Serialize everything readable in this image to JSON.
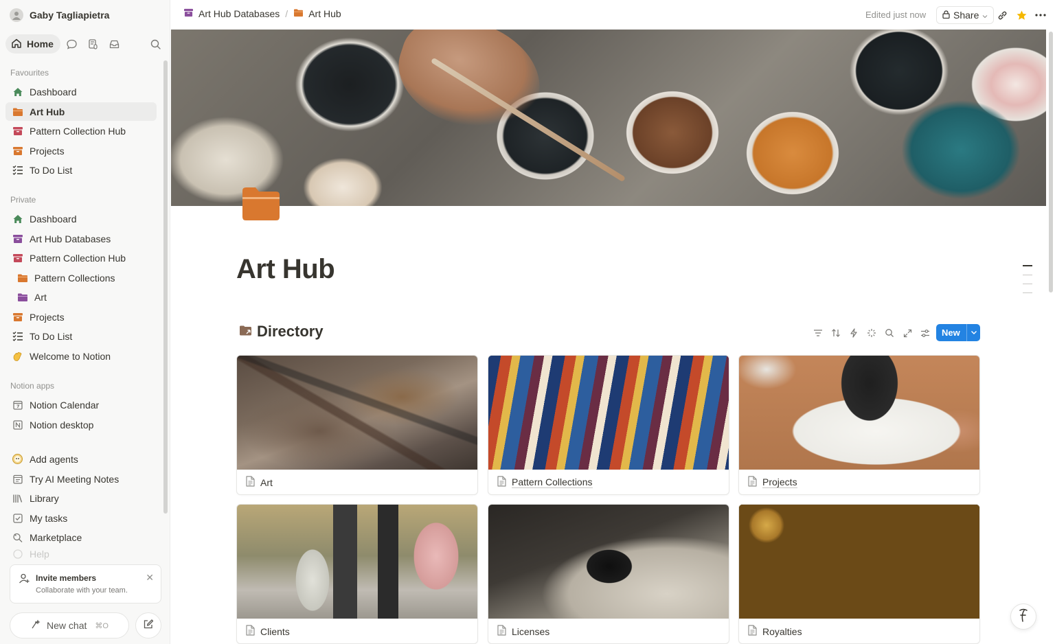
{
  "workspace": {
    "name": "Gaby Tagliapietra"
  },
  "sidebar": {
    "home_label": "Home",
    "favourites_label": "Favourites",
    "favourites": [
      {
        "label": "Dashboard",
        "icon": "house-icon"
      },
      {
        "label": "Art Hub",
        "icon": "folder-icon"
      },
      {
        "label": "Pattern Collection Hub",
        "icon": "archive-icon"
      },
      {
        "label": "Projects",
        "icon": "archive-icon"
      },
      {
        "label": "To Do List",
        "icon": "checklist-icon"
      }
    ],
    "private_label": "Private",
    "private": [
      {
        "label": "Dashboard",
        "icon": "house-icon"
      },
      {
        "label": "Art Hub Databases",
        "icon": "archive-icon"
      },
      {
        "label": "Pattern Collection Hub",
        "icon": "archive-icon"
      },
      {
        "label": "Pattern Collections",
        "icon": "folder-icon"
      },
      {
        "label": "Art",
        "icon": "folder-icon"
      },
      {
        "label": "Projects",
        "icon": "archive-icon"
      },
      {
        "label": "To Do List",
        "icon": "checklist-icon"
      },
      {
        "label": "Welcome to Notion",
        "icon": "wave-icon"
      }
    ],
    "apps_label": "Notion apps",
    "apps": [
      {
        "label": "Notion Calendar",
        "icon": "calendar-icon"
      },
      {
        "label": "Notion desktop",
        "icon": "notion-icon"
      }
    ],
    "tools": [
      {
        "label": "Add agents",
        "icon": "agent-icon"
      },
      {
        "label": "Try AI Meeting Notes",
        "icon": "meeting-notes-icon"
      },
      {
        "label": "Library",
        "icon": "library-icon"
      },
      {
        "label": "My tasks",
        "icon": "tasks-icon"
      },
      {
        "label": "Marketplace",
        "icon": "marketplace-icon"
      },
      {
        "label": "Help",
        "icon": "help-icon"
      }
    ],
    "invite": {
      "title": "Invite members",
      "subtitle": "Collaborate with your team."
    },
    "new_chat": {
      "label": "New chat",
      "shortcut": "⌘O"
    }
  },
  "topbar": {
    "breadcrumbs": [
      "Art Hub Databases",
      "Art Hub"
    ],
    "separator": "/",
    "edited": "Edited just now",
    "share_label": "Share"
  },
  "page": {
    "title": "Art Hub",
    "directory_title": "Directory",
    "new_button": "New",
    "cards": [
      {
        "title": "Art"
      },
      {
        "title": "Pattern Collections"
      },
      {
        "title": "Projects"
      },
      {
        "title": "Clients"
      },
      {
        "title": "Licenses"
      },
      {
        "title": "Royalties"
      }
    ]
  },
  "colors": {
    "accent": "#2383e2",
    "folder": "#d9782f",
    "archive": "#c4495a",
    "archive_purple": "#8a4e9c",
    "house": "#4a8a5a",
    "favorite_star": "#f5b800"
  }
}
